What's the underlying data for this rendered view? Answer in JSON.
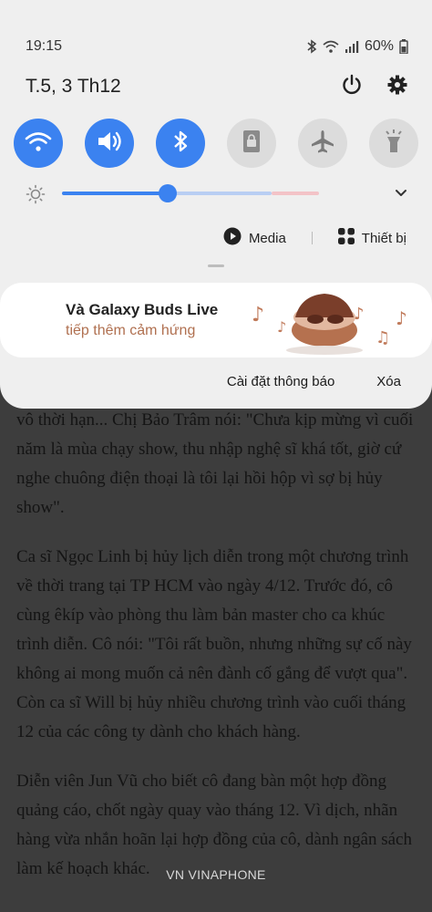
{
  "status_bar": {
    "time": "19:15",
    "battery": "60%"
  },
  "header": {
    "date": "T.5, 3 Th12"
  },
  "quick_settings": [
    {
      "name": "wifi",
      "state": "on"
    },
    {
      "name": "sound",
      "state": "on"
    },
    {
      "name": "bluetooth",
      "state": "on"
    },
    {
      "name": "screen-rotation-lock",
      "state": "off"
    },
    {
      "name": "airplane-mode",
      "state": "off"
    },
    {
      "name": "flashlight",
      "state": "off"
    }
  ],
  "brightness": {
    "level": 0.36
  },
  "media_row": {
    "media_label": "Media",
    "devices_label": "Thiết bị"
  },
  "ad": {
    "line1": "Và Galaxy Buds Live",
    "line2": "tiếp thêm cảm hứng"
  },
  "notification_actions": {
    "settings_label": "Cài đặt thông báo",
    "clear_label": "Xóa"
  },
  "article": {
    "paragraphs": [
      "vô thời hạn... Chị Bảo Trâm nói: \"Chưa kịp mừng vì cuối năm là mùa chạy show, thu nhập nghệ sĩ khá tốt, giờ cứ nghe chuông điện thoại là tôi lại hồi hộp vì sợ bị hủy show\".",
      "Ca sĩ Ngọc Linh bị hủy lịch diễn trong một chương trình về thời trang tại TP HCM vào ngày 4/12. Trước đó, cô cùng êkíp vào phòng thu làm bản master cho ca khúc trình diễn. Cô nói: \"Tôi rất buồn, nhưng những sự cố này không ai mong muốn cả nên đành cố gắng để vượt qua\". Còn ca sĩ Will bị hủy nhiều chương trình vào cuối tháng 12 của các công ty dành cho khách hàng.",
      "Diễn viên Jun Vũ cho biết cô đang bàn một hợp đồng quảng cáo, chốt ngày quay vào tháng 12. Vì dịch, nhãn hàng vừa nhắn hoãn lại hợp đồng của cô, dành ngân sách làm kế hoạch khác."
    ]
  },
  "carrier": "VN VINAPHONE",
  "colors": {
    "accent": "#3b82f0",
    "panel_bg": "#efefef",
    "ad_subtitle": "#b07050"
  }
}
